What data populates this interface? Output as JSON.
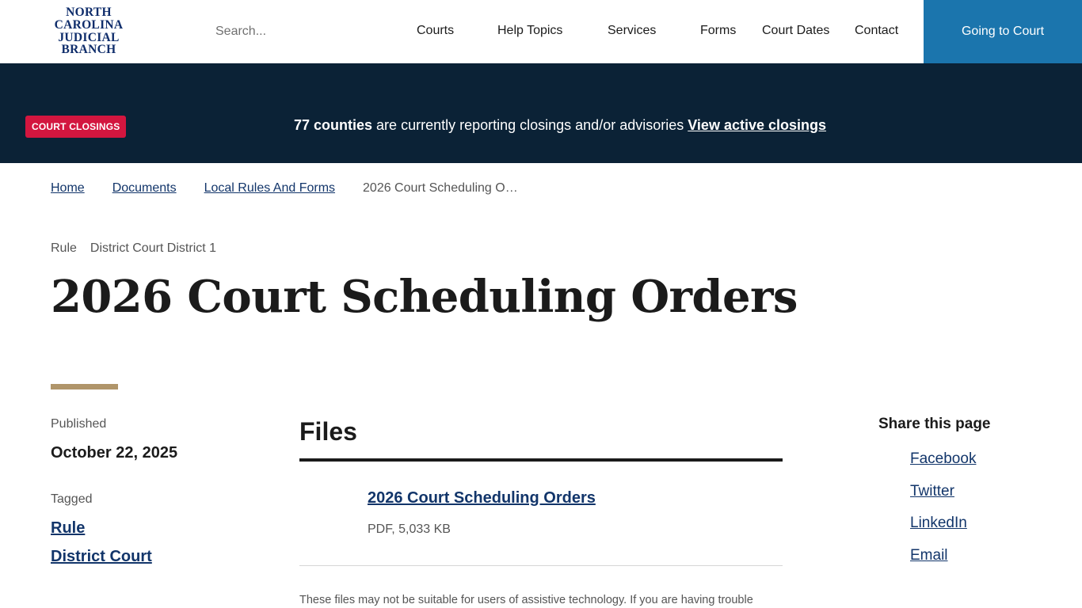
{
  "header": {
    "logo_lines": [
      "NORTH",
      "CAROLINA",
      "JUDICIAL",
      "BRANCH"
    ],
    "search_placeholder": "Search...",
    "nav": [
      "Courts",
      "Help Topics",
      "Services",
      "Forms",
      "Court Dates",
      "Contact"
    ],
    "cta": "Going to Court"
  },
  "alert": {
    "badge": "COURT CLOSINGS",
    "count": "77 counties",
    "message": " are currently reporting closings and/or advisories ",
    "link": "View active closings"
  },
  "breadcrumb": {
    "items": [
      "Home",
      "Documents",
      "Local Rules And Forms"
    ],
    "current": "2026 Court Scheduling O…"
  },
  "meta": [
    "Rule",
    "District Court District 1"
  ],
  "title": "2026 Court Scheduling Orders",
  "sidebar": {
    "published_label": "Published",
    "published_date": "October 22, 2025",
    "tagged_label": "Tagged",
    "tags": [
      "Rule",
      "District Court"
    ]
  },
  "files": {
    "heading": "Files",
    "items": [
      {
        "name": "2026 Court Scheduling Orders ",
        "meta": "PDF, 5,033 KB"
      }
    ],
    "note": "These files may not be suitable for users of assistive technology. If you are having trouble"
  },
  "share": {
    "heading": "Share this page",
    "links": [
      "Facebook",
      "Twitter",
      "LinkedIn",
      "Email"
    ]
  }
}
